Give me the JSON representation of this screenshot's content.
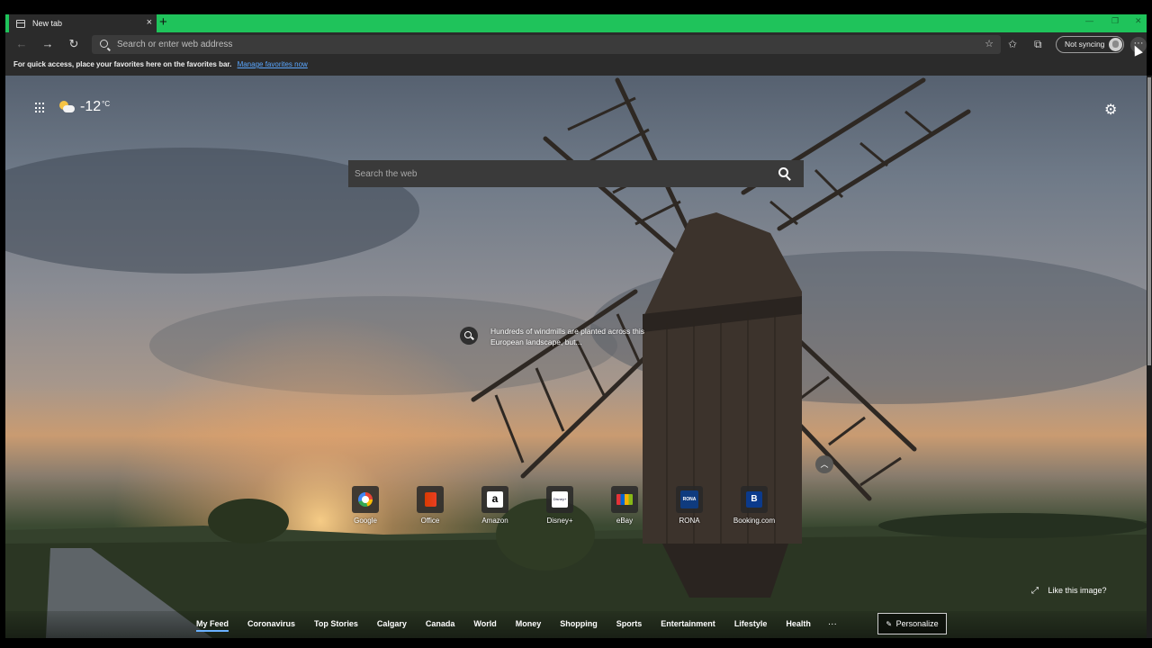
{
  "browser": {
    "tab": {
      "title": "New tab",
      "close_glyph": "×",
      "icon": "newtab-page-icon"
    },
    "new_tab_glyph": "+",
    "window_controls": [
      "—",
      "❐",
      "✕"
    ],
    "address_bar": {
      "placeholder": "Search or enter web address",
      "value": ""
    },
    "sync_label": "Not syncing",
    "more_glyph": "···",
    "favorites_bar": {
      "message": "For quick access, place your favorites here on the favorites bar.",
      "link": "Manage favorites now"
    },
    "colors": {
      "tab_strip": "#1fc35b",
      "toolbar": "#2b2b2b",
      "link": "#5aa7ff"
    }
  },
  "newtab": {
    "weather": {
      "temperature": "-12",
      "unit": "°C",
      "icon": "partly-sunny-icon"
    },
    "search": {
      "placeholder": "Search the web"
    },
    "image_info": "Hundreds of windmills are planted across this European landscape, but...",
    "quick_links": [
      {
        "label": "Google",
        "icon": "google-logo"
      },
      {
        "label": "Office",
        "icon": "office-logo"
      },
      {
        "label": "Amazon",
        "icon": "amazon-logo",
        "glyph": "a"
      },
      {
        "label": "Disney+",
        "icon": "disney-logo",
        "glyph": "Disney+"
      },
      {
        "label": "eBay",
        "icon": "ebay-logo"
      },
      {
        "label": "RONA",
        "icon": "rona-logo",
        "glyph": "RONA"
      },
      {
        "label": "Booking.com",
        "icon": "booking-logo",
        "glyph": "B"
      }
    ],
    "like_image": "Like this image?",
    "feed_tabs": [
      "My Feed",
      "Coronavirus",
      "Top Stories",
      "Calgary",
      "Canada",
      "World",
      "Money",
      "Shopping",
      "Sports",
      "Entertainment",
      "Lifestyle",
      "Health"
    ],
    "feed_more": "···",
    "personalize": "Personalize"
  }
}
